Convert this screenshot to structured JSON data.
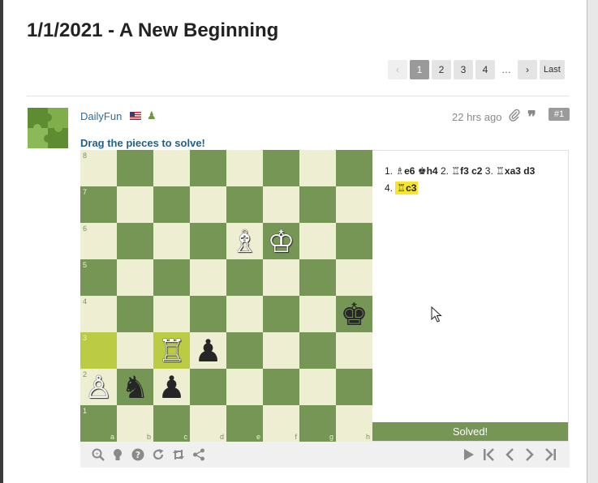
{
  "thread": {
    "title": "1/1/2021 - A New Beginning"
  },
  "pagination": {
    "prev": "‹",
    "pages": [
      "1",
      "2",
      "3",
      "4"
    ],
    "active_page": "1",
    "ellipsis": "…",
    "next": "›",
    "last": "Last"
  },
  "post": {
    "username": "DailyFun",
    "flag": "US",
    "badge_icon": "pawn-icon",
    "timestamp": "22 hrs ago",
    "post_number": "#1",
    "instruction": "Drag the pieces to solve!"
  },
  "board": {
    "ranks": [
      "8",
      "7",
      "6",
      "5",
      "4",
      "3",
      "2",
      "1"
    ],
    "files": [
      "a",
      "b",
      "c",
      "d",
      "e",
      "f",
      "g",
      "h"
    ],
    "highlighted_squares": [
      "a3",
      "c3"
    ],
    "pieces": {
      "e6": {
        "glyph": "♗",
        "color": "w",
        "name": "white-bishop"
      },
      "f6": {
        "glyph": "♔",
        "color": "w",
        "name": "white-king"
      },
      "h4": {
        "glyph": "♚",
        "color": "b",
        "name": "black-king"
      },
      "c3": {
        "glyph": "♖",
        "color": "w",
        "name": "white-rook"
      },
      "d3": {
        "glyph": "♟",
        "color": "b",
        "name": "black-pawn"
      },
      "a2": {
        "glyph": "♙",
        "color": "w",
        "name": "white-pawn"
      },
      "b2": {
        "glyph": "♞",
        "color": "b",
        "name": "black-knight"
      },
      "c2": {
        "glyph": "♟",
        "color": "b",
        "name": "black-pawn"
      }
    }
  },
  "moves": {
    "m1_num": "1.",
    "m1_w_fig": "♗",
    "m1_w": "e6",
    "m1_b_fig": "♚",
    "m1_b": "h4",
    "m2_num": "2.",
    "m2_w_fig": "♖",
    "m2_w": "f3",
    "m2_b": "c2",
    "m3_num": "3.",
    "m3_w_fig": "♖",
    "m3_w": "xa3",
    "m3_b": "d3",
    "m4_num": "4.",
    "m4_w_fig": "♖",
    "m4_w": "c3",
    "status": "Solved!"
  },
  "toolbar": {
    "left_icons": [
      "analyze-icon",
      "hint-icon",
      "help-icon",
      "reset-icon",
      "flip-board-icon",
      "share-icon"
    ],
    "right_icons": [
      "play-icon",
      "first-move-icon",
      "prev-move-icon",
      "next-move-icon",
      "last-move-icon"
    ]
  },
  "colors": {
    "light_square": "#eeeed2",
    "dark_square": "#769656",
    "highlight": "#bbcb44",
    "link": "#2b6ea6",
    "current_move": "#f5e52c"
  }
}
